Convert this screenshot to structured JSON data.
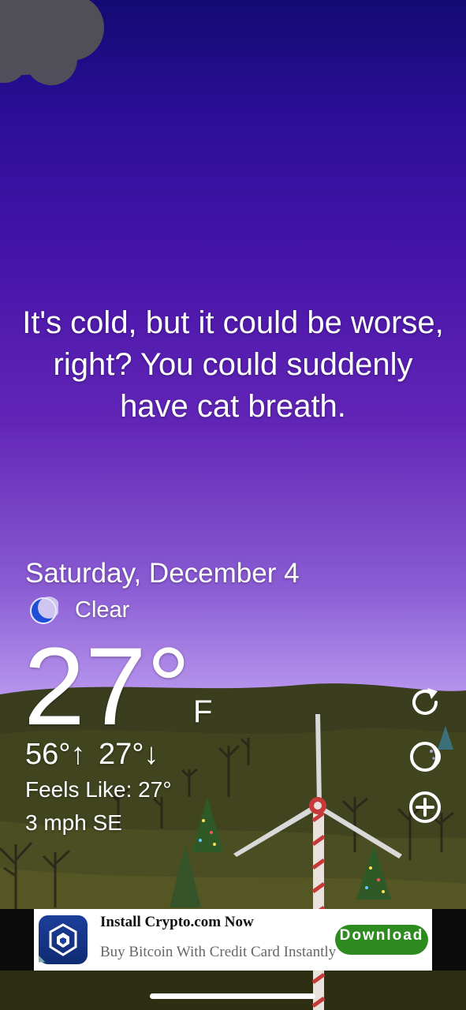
{
  "quote": "It's cold, but it could be worse, right? You could suddenly have cat breath.",
  "weather": {
    "date": "Saturday, December 4",
    "condition": "Clear",
    "condition_icon": "moon-icon",
    "temperature": "27°",
    "unit": "F",
    "high": "56°",
    "low": "27°",
    "high_arrow": "↑",
    "low_arrow": "↓",
    "feels_like": "Feels Like: 27°",
    "wind": "3 mph SE"
  },
  "actions": {
    "refresh_icon": "refresh-icon",
    "moon_phase_icon": "moon-phase-icon",
    "add_icon": "add-icon"
  },
  "ad": {
    "title": "Install Crypto.com Now",
    "subtitle": "Buy Bitcoin With Credit Card Instantly",
    "button": "Download",
    "app_icon": "crypto-com-icon"
  },
  "colors": {
    "sky_top": "#140a73",
    "sky_bottom": "#d0b4f5",
    "hills": "#3b3d1f",
    "ad_button": "#2e8b1f"
  }
}
